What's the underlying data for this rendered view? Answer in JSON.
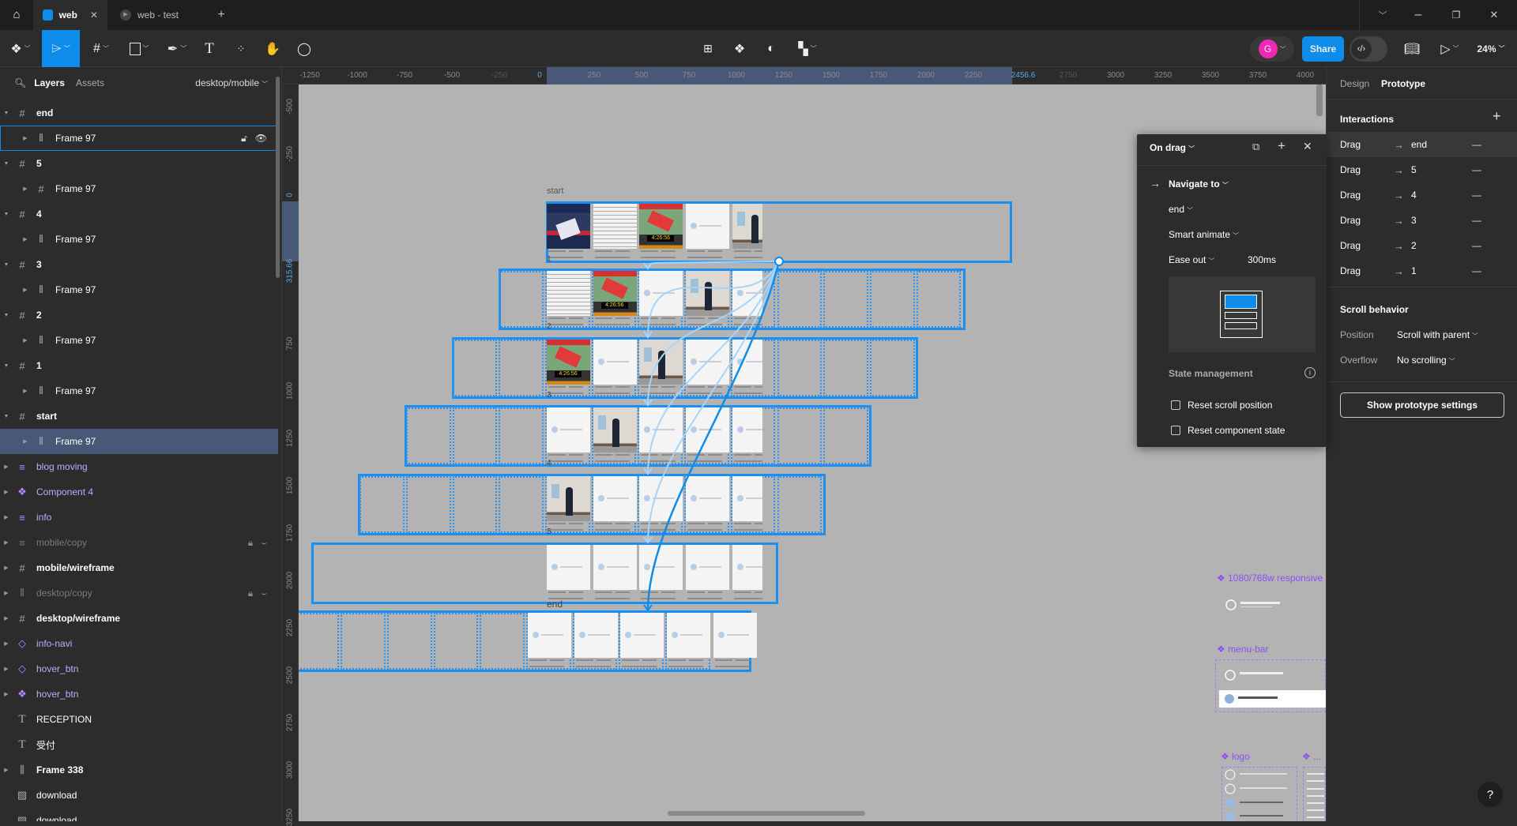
{
  "tabs": [
    {
      "label": "web",
      "icon": "figma-file-icon",
      "active": true
    },
    {
      "label": "web - test",
      "icon": "play-icon",
      "active": false
    }
  ],
  "toolbar": {
    "share_label": "Share",
    "zoom": "24%",
    "avatar_initial": "G",
    "avatar_color": "#f028b5",
    "accent": "#0d8ce9"
  },
  "left_panel": {
    "tab_layers": "Layers",
    "tab_assets": "Assets",
    "page": "desktop/mobile"
  },
  "layers": [
    {
      "name": "end",
      "icon": "frame-icon",
      "level": 0,
      "expanded": true,
      "bold": true
    },
    {
      "name": "Frame 97",
      "icon": "autolayout-icon",
      "level": 1,
      "hovered": true,
      "locked_icon": "unlock-icon",
      "visible_icon": "eye-icon"
    },
    {
      "name": "5",
      "icon": "frame-icon",
      "level": 0,
      "expanded": true,
      "bold": true
    },
    {
      "name": "Frame 97",
      "icon": "frame-icon",
      "level": 1
    },
    {
      "name": "4",
      "icon": "frame-icon",
      "level": 0,
      "expanded": true,
      "bold": true
    },
    {
      "name": "Frame 97",
      "icon": "autolayout-icon",
      "level": 1
    },
    {
      "name": "3",
      "icon": "frame-icon",
      "level": 0,
      "expanded": true,
      "bold": true
    },
    {
      "name": "Frame 97",
      "icon": "autolayout-icon",
      "level": 1
    },
    {
      "name": "2",
      "icon": "frame-icon",
      "level": 0,
      "expanded": true,
      "bold": true
    },
    {
      "name": "Frame 97",
      "icon": "autolayout-icon",
      "level": 1
    },
    {
      "name": "1",
      "icon": "frame-icon",
      "level": 0,
      "expanded": true,
      "bold": true
    },
    {
      "name": "Frame 97",
      "icon": "autolayout-icon",
      "level": 1
    },
    {
      "name": "start",
      "icon": "frame-icon",
      "level": 0,
      "expanded": true,
      "bold": true
    },
    {
      "name": "Frame 97",
      "icon": "autolayout-icon",
      "level": 1,
      "selected": true
    },
    {
      "name": "blog moving",
      "icon": "vertical-list-icon",
      "level": 0,
      "style": "purple"
    },
    {
      "name": "Component 4",
      "icon": "component-icon",
      "level": 0,
      "style": "purple"
    },
    {
      "name": "info",
      "icon": "vertical-list-icon",
      "level": 0,
      "style": "purple"
    },
    {
      "name": "mobile/copy",
      "icon": "vertical-list-icon",
      "level": 0,
      "style": "dim",
      "locked": true,
      "hidden": true
    },
    {
      "name": "mobile/wireframe",
      "icon": "frame-icon",
      "level": 0,
      "bold": true
    },
    {
      "name": "desktop/copy",
      "icon": "autolayout-icon",
      "level": 0,
      "style": "dim",
      "locked": true,
      "hidden": true
    },
    {
      "name": "desktop/wireframe",
      "icon": "frame-icon",
      "level": 0,
      "bold": true
    },
    {
      "name": "info-navi",
      "icon": "instance-icon",
      "level": 0,
      "style": "purple"
    },
    {
      "name": "hover_btn",
      "icon": "instance-icon",
      "level": 0,
      "style": "purple"
    },
    {
      "name": "hover_btn",
      "icon": "component-icon",
      "level": 0,
      "style": "purple"
    },
    {
      "name": "RECEPTION",
      "icon": "text-icon",
      "level": 0,
      "no_chevron": true
    },
    {
      "name": "受付",
      "icon": "text-icon",
      "level": 0,
      "no_chevron": true
    },
    {
      "name": "Frame 338",
      "icon": "autolayout-horizontal-icon",
      "level": 0,
      "bold": true
    },
    {
      "name": "download",
      "icon": "image-icon",
      "level": 0,
      "no_chevron": true
    },
    {
      "name": "download",
      "icon": "image-icon",
      "level": 0,
      "no_chevron": true
    }
  ],
  "rulers": {
    "h_ticks": [
      "-1250",
      "-1000",
      "-750",
      "-500",
      "-250",
      "0",
      "250",
      "500",
      "750",
      "1000",
      "1250",
      "1500",
      "1750",
      "2000",
      "2250",
      "2456.6",
      "2750",
      "3000",
      "3250",
      "3500",
      "3750",
      "4000"
    ],
    "v_ticks": [
      "-500",
      "-250",
      "0",
      "315.66",
      "750",
      "1000",
      "1250",
      "1500",
      "1750",
      "2000",
      "2250",
      "2500",
      "2750",
      "3000",
      "3250"
    ],
    "selection_start": "0",
    "selection_end_x": "2456.6",
    "selection_end_y": "315.66"
  },
  "canvas": {
    "frame_title": "start",
    "row_labels": [
      "1",
      "2",
      "3",
      "4",
      "5",
      "end"
    ],
    "components": [
      {
        "label": "1080/768w responsive"
      },
      {
        "label": "menu-bar"
      },
      {
        "label": "logo"
      },
      {
        "label": "..."
      }
    ],
    "connection_light": "#a6d4fa",
    "connection_dark": "#0d8ce9"
  },
  "popup": {
    "trigger": "On drag",
    "action": "Navigate to",
    "destination": "end",
    "animation": "Smart animate",
    "easing": "Ease out",
    "duration": "300ms",
    "state_title": "State management",
    "reset_scroll": "Reset scroll position",
    "reset_component": "Reset component state",
    "reset_scroll_checked": false,
    "reset_component_checked": false
  },
  "right_panel": {
    "tab_design": "Design",
    "tab_prototype": "Prototype",
    "interactions_title": "Interactions",
    "interactions": [
      {
        "trigger": "Drag",
        "target": "end"
      },
      {
        "trigger": "Drag",
        "target": "5"
      },
      {
        "trigger": "Drag",
        "target": "4"
      },
      {
        "trigger": "Drag",
        "target": "3"
      },
      {
        "trigger": "Drag",
        "target": "2"
      },
      {
        "trigger": "Drag",
        "target": "1"
      }
    ],
    "scroll_title": "Scroll behavior",
    "position_label": "Position",
    "position_value": "Scroll with parent",
    "overflow_label": "Overflow",
    "overflow_value": "No scrolling",
    "settings_button": "Show prototype settings"
  },
  "help": "?"
}
